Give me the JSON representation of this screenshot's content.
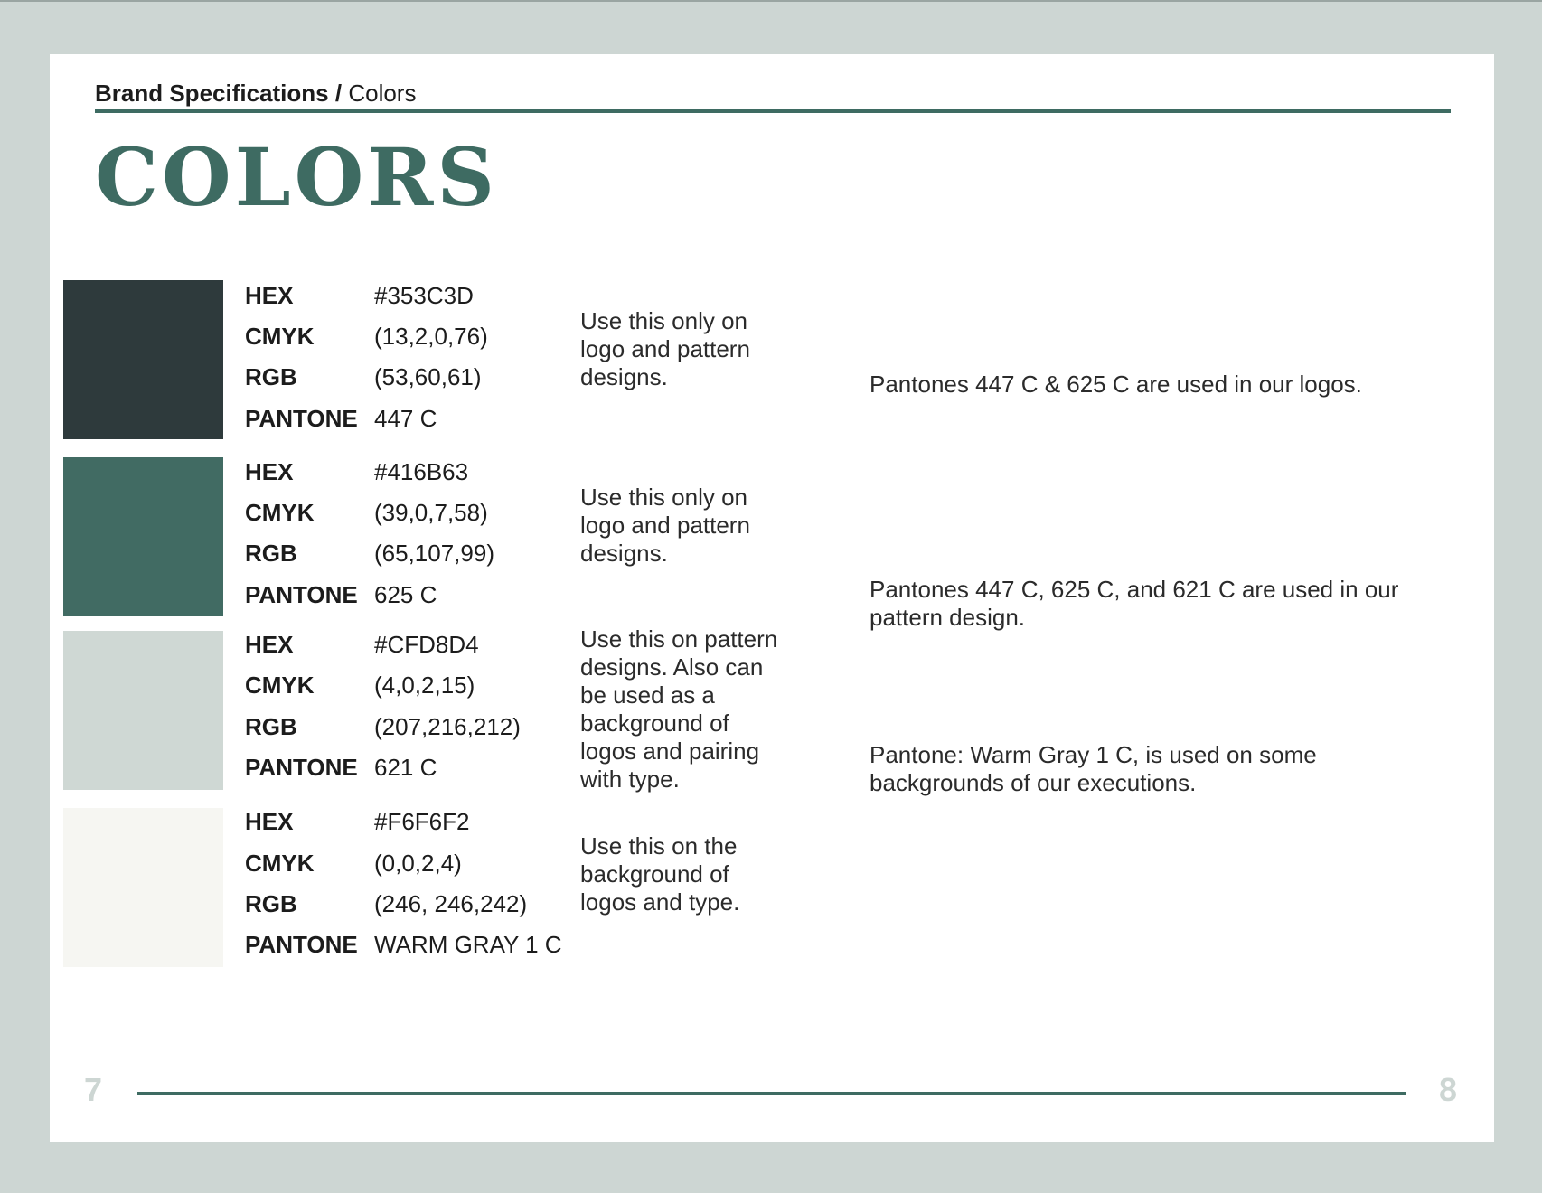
{
  "header": {
    "section": "Brand Specifications",
    "separator": "/",
    "subsection": "Colors"
  },
  "page_title": "COLORS",
  "colors": [
    {
      "swatch": "#2E3A3C",
      "hex_label": "HEX",
      "hex": "#353C3D",
      "cmyk_label": "CMYK",
      "cmyk": "(13,2,0,76)",
      "rgb_label": "RGB",
      "rgb": "(53,60,61)",
      "pantone_label": "PANTONE",
      "pantone": "447 C",
      "usage": "Use this only on logo and pattern designs."
    },
    {
      "swatch": "#416B63",
      "hex_label": "HEX",
      "hex": "#416B63",
      "cmyk_label": "CMYK",
      "cmyk": "(39,0,7,58)",
      "rgb_label": "RGB",
      "rgb": "(65,107,99)",
      "pantone_label": "PANTONE",
      "pantone": "625 C",
      "usage": "Use this only on logo and pattern designs."
    },
    {
      "swatch": "#CFD8D4",
      "hex_label": "HEX",
      "hex": "#CFD8D4",
      "cmyk_label": "CMYK",
      "cmyk": "(4,0,2,15)",
      "rgb_label": "RGB",
      "rgb": "(207,216,212)",
      "pantone_label": "PANTONE",
      "pantone": "621 C",
      "usage": "Use this on pattern designs. Also can be used as a background of logos and pairing with type."
    },
    {
      "swatch": "#F6F6F2",
      "hex_label": "HEX",
      "hex": "#F6F6F2",
      "cmyk_label": "CMYK",
      "cmyk": "(0,0,2,4)",
      "rgb_label": "RGB",
      "rgb": "(246, 246,242)",
      "pantone_label": "PANTONE",
      "pantone": "WARM GRAY 1 C",
      "usage": "Use this on the background of logos and type."
    }
  ],
  "notes": [
    "Pantones 447 C & 625 C are used in our logos.",
    "Pantones 447 C,  625 C, and 621 C are used in our pattern design.",
    "Pantone: Warm Gray 1 C, is used on some backgrounds of our executions."
  ],
  "footer": {
    "page_left": "7",
    "page_right": "8"
  },
  "theme": {
    "accent": "#3E6B62",
    "background": "#CDD6D3",
    "page": "#FFFFFF"
  }
}
